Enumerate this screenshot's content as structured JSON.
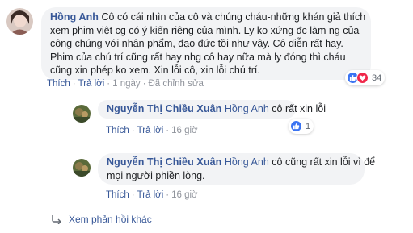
{
  "comment": {
    "author": "Hồng Anh",
    "lines": [
      "Cô có cái nhìn của cô và chúng cháu-những khán giả thích",
      "xem phim việt cg có ý kiến riêng của mình. Ly ko xứng đc làm ng của",
      "công chúng với nhân phẩm, đạo đức tồi như vậy. Cô diễn rất hay.",
      "Phim của chú trí cũng rất hay nhg cô hay nữa mà ly đóng thì cháu",
      "cũng xin phép ko xem. Xin lỗi cô, xin lỗi chú trí."
    ],
    "actions": {
      "like": "Thích",
      "reply": "Trả lời",
      "time": "1 ngày",
      "edited": "Đã chỉnh sửa"
    },
    "reactions": {
      "icons": [
        "like-icon",
        "heart-icon"
      ],
      "count": "34"
    }
  },
  "replies": [
    {
      "author": "Nguyễn Thị Chiều Xuân",
      "tag": "Hồng Anh",
      "text": "cô rất xin lỗi",
      "lines": [],
      "actions": {
        "like": "Thích",
        "reply": "Trả lời",
        "time": "16 giờ"
      },
      "reactions": {
        "icons": [
          "like-icon"
        ],
        "count": "1"
      }
    },
    {
      "author": "Nguyễn Thị Chiều Xuân",
      "tag": "Hồng Anh",
      "text": "cô cũng rất xin lỗi vì để",
      "lines": [
        "mọi người phiền lòng."
      ],
      "actions": {
        "like": "Thích",
        "reply": "Trả lời",
        "time": "16 giờ"
      }
    }
  ],
  "more_replies": {
    "icon": "reply-arrow-icon",
    "label": "Xem phản hồi khác"
  },
  "colors": {
    "link": "#385898",
    "bubble": "#f2f3f5",
    "like": "#3b74f2",
    "heart": "#f0284a"
  }
}
